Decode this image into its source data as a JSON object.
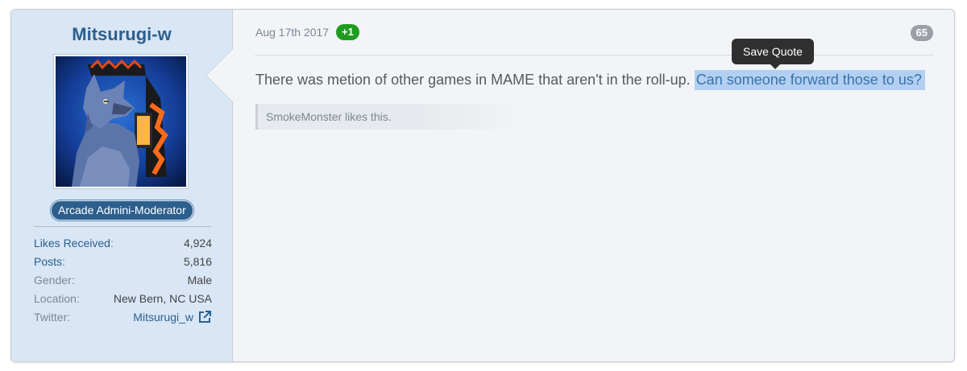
{
  "user": {
    "username": "Mitsurugi-w",
    "role": "Arcade Admini-Moderator",
    "stats": [
      {
        "label": "Likes Received",
        "value": "4,924",
        "label_link": true
      },
      {
        "label": "Posts",
        "value": "5,816",
        "label_link": true
      },
      {
        "label": "Gender:",
        "value": "Male",
        "label_link": false
      },
      {
        "label": "Location:",
        "value": "New Bern, NC USA",
        "label_link": false
      },
      {
        "label": "Twitter:",
        "value": "Mitsurugi_w",
        "label_link": false
      }
    ]
  },
  "post": {
    "date": "Aug 17th 2017",
    "reputation": "+1",
    "number": "65",
    "text_before": "There was metion of other games in MAME that aren't in the roll-up. ",
    "text_selected": "Can someone forward those to us?",
    "likes_text": "SmokeMonster likes this.",
    "tooltip": "Save Quote"
  },
  "colors": {
    "accent": "#2c5f8e",
    "sidebar_bg": "#d8e6f5",
    "reputation_badge": "#1f9b1f",
    "selection": "#b3d0f2",
    "tooltip_bg": "#2f2f2f"
  },
  "icons": {
    "external_link": "external-link-icon"
  }
}
